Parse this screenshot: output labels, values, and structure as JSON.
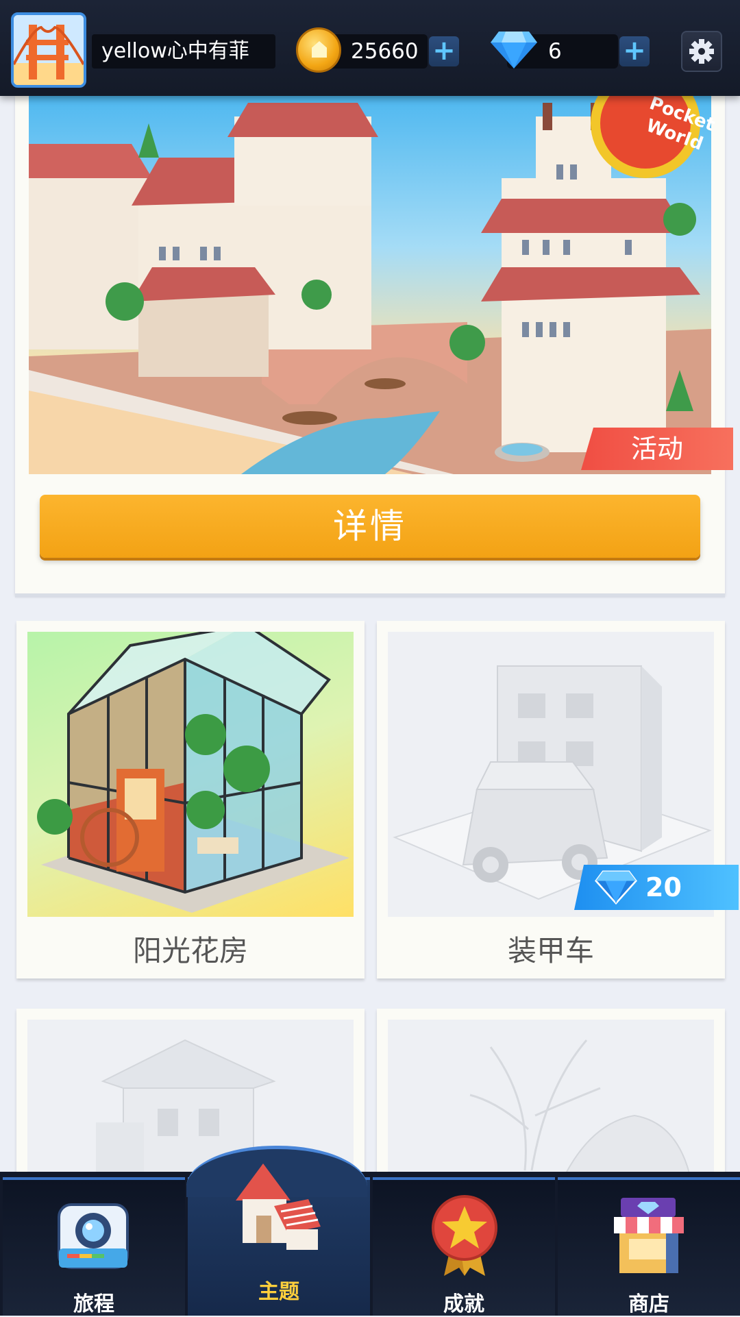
{
  "header": {
    "username": "yellow心中有菲",
    "coins": "25660",
    "gems": "6",
    "coin_icon": "coin-icon",
    "gem_icon": "diamond-icon",
    "add_label": "+",
    "settings_icon": "gear-icon"
  },
  "event": {
    "banner_badge": "Pocket World",
    "tag": "活动",
    "button_label": "详情"
  },
  "themes": [
    {
      "name": "阳光花房",
      "locked": false
    },
    {
      "name": "装甲车",
      "locked": true,
      "price": "20"
    },
    {
      "name": "",
      "locked": true
    },
    {
      "name": "",
      "locked": true
    }
  ],
  "bottom_nav": [
    {
      "label": "旅程",
      "icon": "camera-icon",
      "active": false
    },
    {
      "label": "主题",
      "icon": "house-icon",
      "active": true
    },
    {
      "label": "成就",
      "icon": "medal-icon",
      "active": false
    },
    {
      "label": "商店",
      "icon": "shop-icon",
      "active": false
    }
  ],
  "colors": {
    "accent_orange": "#f7a91e",
    "activity_red": "#f15a4a",
    "gem_blue": "#2fa6f5",
    "nav_active_text": "#ffcf3c",
    "topbar_bg": "#1a2030"
  }
}
